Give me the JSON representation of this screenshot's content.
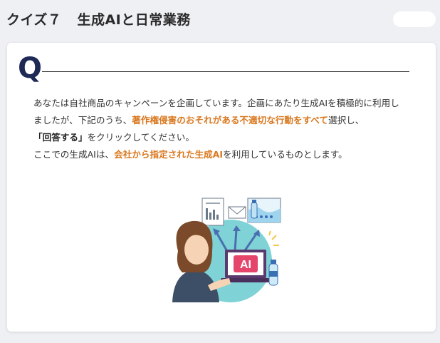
{
  "header": {
    "quiz_label": "クイズ７",
    "quiz_title": "生成AIと日常業務"
  },
  "question": {
    "marker": "Q",
    "part1": "あなたは自社商品のキャンペーンを企画しています。企画にあたり生成AIを積極的に利用しましたが、下記のうち、",
    "highlight1": "著作権侵害のおそれがある不適切な行動をすべて",
    "part2": "選択し、",
    "answer_button_ref": "「回答する」",
    "part3": "をクリックしてください。",
    "part4": "ここでの生成AIは、",
    "highlight2": "会社から指定された生成AI",
    "part5": "を利用しているものとします。"
  },
  "illustration": {
    "ai_badge": "AI"
  },
  "colors": {
    "accent": "#d9771e",
    "q_marker": "#1e2a55"
  }
}
